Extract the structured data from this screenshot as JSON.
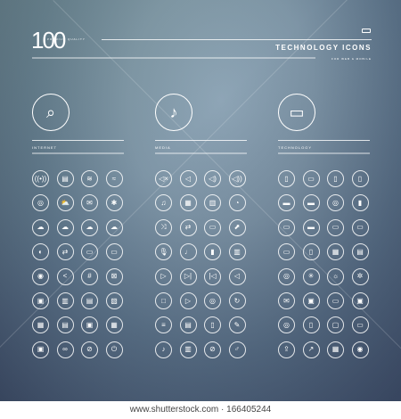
{
  "header": {
    "count": "100",
    "tagline": "PREMIUM QUALITY",
    "title": "TECHNOLOGY ICONS",
    "subtitle": "FOR WEB & MOBILE"
  },
  "categories": [
    {
      "label": "INTERNET",
      "icon": "globe-search-icon",
      "glyph": "⌕"
    },
    {
      "label": "MEDIA",
      "icon": "playlist-music-icon",
      "glyph": "♪"
    },
    {
      "label": "TECHNOLOGY",
      "icon": "laptop-icon",
      "glyph": "▭"
    }
  ],
  "icon_glyphs": [
    [
      "((•))",
      "▤",
      "≋",
      "≈",
      "◎",
      "⛅",
      "✉",
      "✱",
      "☁",
      "☁",
      "☁",
      "☁",
      "◐",
      "⇄",
      "▭",
      "▭",
      "◉",
      "<",
      "#",
      "⊠",
      "▣",
      "▥",
      "▤",
      "▧",
      "▦",
      "▤",
      "▣",
      "▦",
      "▣",
      "∞",
      "⊘",
      "⏻"
    ],
    [
      "◁×",
      "◁",
      "◁)",
      "◁))",
      "♫",
      "▦",
      "▥",
      "◔",
      "⤨",
      "⇄",
      "▭",
      "⬈",
      "🎙",
      "♩",
      "▮",
      "▥",
      "▷",
      "▷|",
      "|◁",
      "◁",
      "□",
      "▷",
      "◎",
      "↻",
      "≡",
      "▤",
      "▯",
      "✎",
      "♪",
      "▥",
      "⊘",
      "♂"
    ],
    [
      "▯",
      "▭",
      "▯",
      "▯",
      "▬",
      "▬",
      "◎",
      "▮",
      "▭",
      "▬",
      "▭",
      "▭",
      "▭",
      "▯",
      "▦",
      "▤",
      "◎",
      "✳",
      "☼",
      "✲",
      "✉",
      "▣",
      "▭",
      "▣",
      "◎",
      "▯",
      "▢",
      "▭",
      "⇪",
      "↗",
      "▦",
      "◉"
    ]
  ],
  "footer": "www.shutterstock.com · 166405244"
}
